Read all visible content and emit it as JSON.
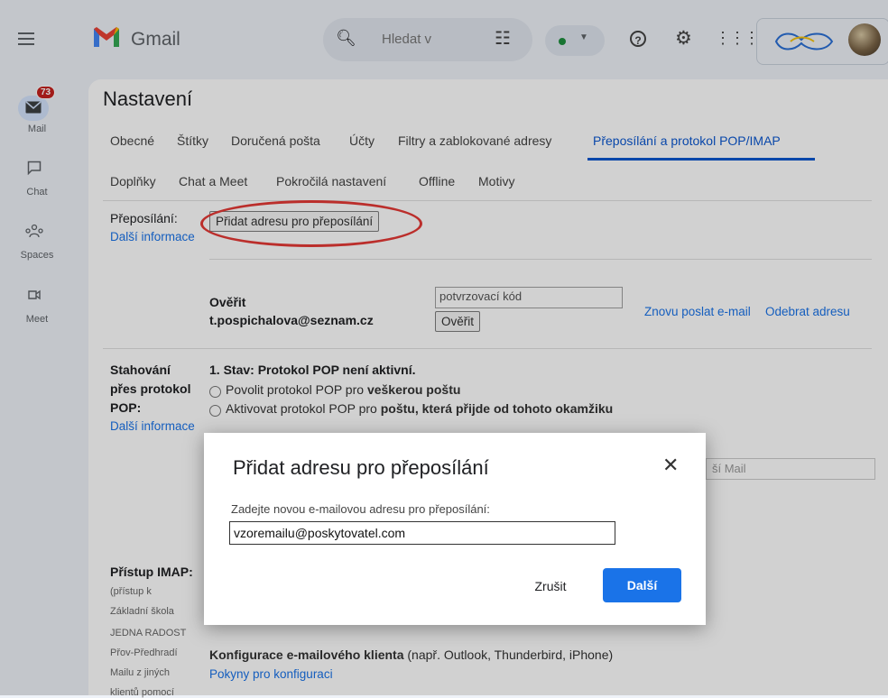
{
  "app": {
    "name": "Gmail"
  },
  "search": {
    "placeholder": "Hledat v"
  },
  "rail": {
    "mail_badge": "73",
    "items": [
      {
        "label": "Mail"
      },
      {
        "label": "Chat"
      },
      {
        "label": "Spaces"
      },
      {
        "label": "Meet"
      }
    ]
  },
  "settings": {
    "title": "Nastavení",
    "tabs_row1": [
      "Obecné",
      "Štítky",
      "Doručená pošta",
      "Účty",
      "Filtry a zablokované adresy",
      "Přeposílání a protokol POP/IMAP"
    ],
    "tabs_row2": [
      "Doplňky",
      "Chat a Meet",
      "Pokročilá nastavení",
      "Offline",
      "Motivy"
    ],
    "forwarding": {
      "label": "Přeposílání:",
      "more_info": "Další informace",
      "add_button": "Přidat adresu pro přeposílání",
      "verify_label": "Ověřit",
      "email": "t.pospichalova@seznam.cz",
      "code_placeholder": "potvrzovací kód",
      "verify_button": "Ověřit",
      "resend_link": "Znovu poslat e-mail",
      "remove_link": "Odebrat adresu"
    },
    "pop": {
      "label_line1": "Stahování",
      "label_line2": "přes protokol",
      "label_line3": "POP:",
      "more_info": "Další informace",
      "status": "1. Stav: Protokol POP není aktivní.",
      "option1_prefix": "Povolit protokol POP pro ",
      "option1_bold": "veškerou poštu",
      "option2_prefix": "Aktivovat protokol POP pro ",
      "option2_bold": "poštu, která přijde od tohoto okamžiku",
      "dropdown_peek": "ší Mail"
    },
    "imap": {
      "label": "Přístup IMAP:",
      "side_lines": [
        "(přístup k",
        "Základní škola",
        "JEDNA RADOST",
        "Přov-Předhradí",
        "Mailu z jiných",
        "klientů pomocí"
      ],
      "client_config_bold": "Konfigurace e-mailového klienta",
      "client_config_rest": " (např. Outlook, Thunderbird, iPhone)",
      "config_link": "Pokyny pro konfiguraci"
    }
  },
  "dialog": {
    "title": "Přidat adresu pro přeposílání",
    "label": "Zadejte novou e-mailovou adresu pro přeposílání:",
    "input_value": "vzoremailu@poskytovatel.com",
    "cancel": "Zrušit",
    "next": "Další"
  },
  "colors": {
    "accent": "#1a73e8",
    "badge": "#c5221f",
    "highlight_ring": "#e53935"
  },
  "icons": [
    "menu-icon",
    "search-icon",
    "tune-icon",
    "help-icon",
    "gear-icon",
    "apps-icon",
    "mail-icon",
    "chat-icon",
    "spaces-icon",
    "meet-icon",
    "close-icon"
  ]
}
